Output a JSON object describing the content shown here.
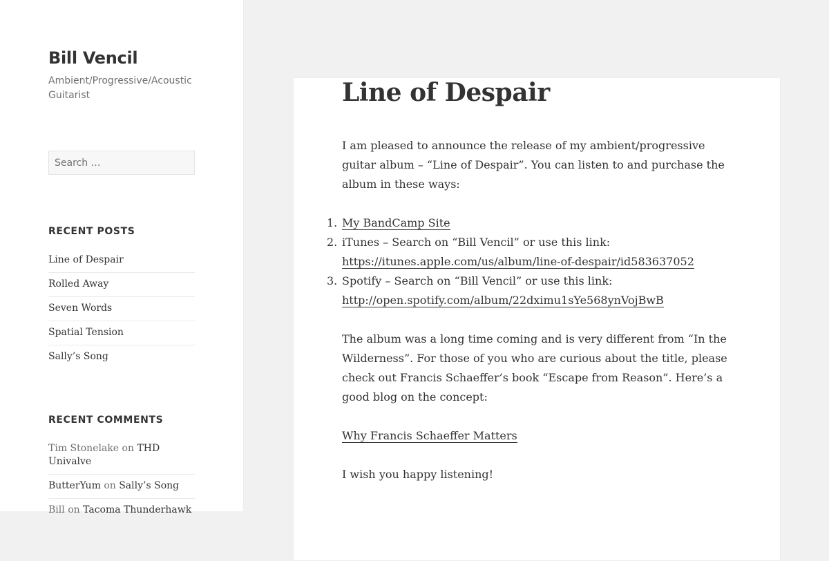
{
  "site": {
    "title": "Bill Vencil",
    "description": "Ambient/Progressive/Acoustic Guitarist"
  },
  "search": {
    "placeholder": "Search …"
  },
  "recent_posts": {
    "heading": "RECENT POSTS",
    "items": [
      "Line of Despair",
      "Rolled Away",
      "Seven Words",
      "Spatial Tension",
      "Sally’s Song"
    ]
  },
  "recent_comments": {
    "heading": "RECENT COMMENTS",
    "on_word": "on",
    "items": [
      {
        "author": "Tim Stonelake",
        "post": "THD Univalve"
      },
      {
        "author": "ButterYum",
        "post": "Sally’s Song"
      },
      {
        "author": "Bill",
        "post": "Tacoma Thunderhawk"
      }
    ]
  },
  "article": {
    "title": "Line of Despair",
    "intro": "I am pleased to announce the release of my ambient/progressive guitar album – “Line of Despair”. You can listen to and purchase the album in these ways:",
    "list": [
      {
        "num": "1.",
        "link": "My BandCamp Site"
      },
      {
        "num": "2.",
        "text": "iTunes – Search on “Bill Vencil” or use this link: ",
        "link": "https://itunes.apple.com/us/album/line-of-despair/id583637052"
      },
      {
        "num": "3.",
        "text": "Spotify – Search on “Bill Vencil” or use this link:  ",
        "link": "http://open.spotify.com/album/22dximu1sYe568ynVojBwB"
      }
    ],
    "para2": "The album was a long time coming and is very different from “In the Wilderness”. For those of you who are curious about the title, please check out Francis Schaeffer’s book “Escape from Reason”.  Here’s a good blog on the concept:",
    "blog_link": "Why Francis Schaeffer Matters",
    "closing": "I wish you happy listening!"
  }
}
